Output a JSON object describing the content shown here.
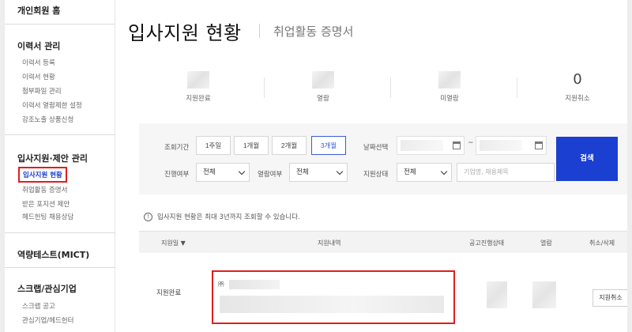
{
  "sidebar": {
    "home": "개인회원 홈",
    "sections": [
      {
        "title": "이력서 관리",
        "items": [
          "이력서 등록",
          "이력서 현황",
          "첨부파일 관리",
          "이력서 열람제한 설정",
          "강조노출 상품신청"
        ]
      },
      {
        "title": "입사지원·제안 관리",
        "items": [
          "입사지원 현황",
          "취업활동 증명서",
          "받은 포지션 제안",
          "헤드헌팅 채용상담"
        ]
      },
      {
        "title": "역량테스트(MICT)",
        "items": []
      },
      {
        "title": "스크랩/관심기업",
        "items": [
          "스크랩 공고",
          "관심기업/헤드헌터"
        ]
      }
    ],
    "active_item": "입사지원 현황"
  },
  "header": {
    "title": "입사지원 현황",
    "subtitle": "취업활동 증명서"
  },
  "stats": [
    {
      "label": "지원완료",
      "value": ""
    },
    {
      "label": "열람",
      "value": ""
    },
    {
      "label": "미열람",
      "value": ""
    },
    {
      "label": "지원취소",
      "value": "0"
    }
  ],
  "filter": {
    "period_label": "조회기간",
    "periods": [
      "1주일",
      "1개월",
      "2개월",
      "3개월"
    ],
    "active_period": "3개월",
    "date_label": "날짜선택",
    "date_separator": "~",
    "progress_label": "진행여부",
    "progress_value": "전체",
    "read_label": "열람여부",
    "read_value": "전체",
    "status_label": "지원상태",
    "status_value": "전체",
    "keyword_placeholder": "기업명, 채용제목",
    "search_button": "검색"
  },
  "notice": "입사지원 현황은 최대 3년까지 조회할 수 있습니다.",
  "table": {
    "headers": [
      "지원일 ▼",
      "지원내역",
      "공고진행상태",
      "열람",
      "취소/삭제"
    ],
    "rows": [
      {
        "status": "지원완료",
        "company_prefix": "㈜",
        "action": "지원취소"
      }
    ]
  },
  "colors": {
    "accent": "#1a3fd1",
    "highlight": "#e01e1e"
  }
}
